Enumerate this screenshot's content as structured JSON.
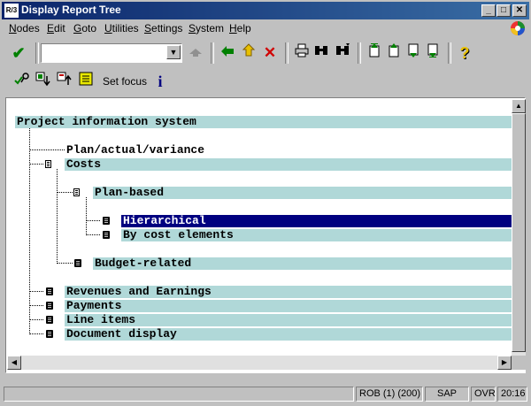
{
  "window": {
    "title": "Display Report Tree",
    "app_icon": "R/3"
  },
  "window_buttons": {
    "minimize": "_",
    "maximize": "□",
    "close": "✕"
  },
  "menu": [
    "Nodes",
    "Edit",
    "Goto",
    "Utilities",
    "Settings",
    "System",
    "Help"
  ],
  "toolbar": {
    "command_field_value": "",
    "dropdown_symbol": "▼",
    "icons": [
      "enter-check-icon",
      "save-icon",
      "back-arrow-icon",
      "exit-up-icon",
      "cancel-x-icon",
      "print-icon",
      "find-icon",
      "find-next-icon",
      "first-page-icon",
      "previous-page-icon",
      "next-page-icon",
      "last-page-icon",
      "help-question-icon"
    ]
  },
  "app_toolbar": {
    "set_focus_label": "Set focus",
    "icons": [
      "select-key-icon",
      "expand-subtree-icon",
      "collapse-subtree-icon",
      "list-icon",
      "info-icon"
    ]
  },
  "tree": {
    "root": "Project information system",
    "nodes": [
      "Plan/actual/variance",
      "Costs",
      "Plan-based",
      "Hierarchical",
      "By cost elements",
      "Budget-related",
      "Revenues and Earnings",
      "Payments",
      "Line items",
      "Document display"
    ],
    "selected": "Hierarchical",
    "highlighted": "Plan/actual/variance"
  },
  "status": {
    "system_info": "ROB (1) (200)",
    "sap": "SAP",
    "mode": "OVR",
    "time": "20:16"
  }
}
